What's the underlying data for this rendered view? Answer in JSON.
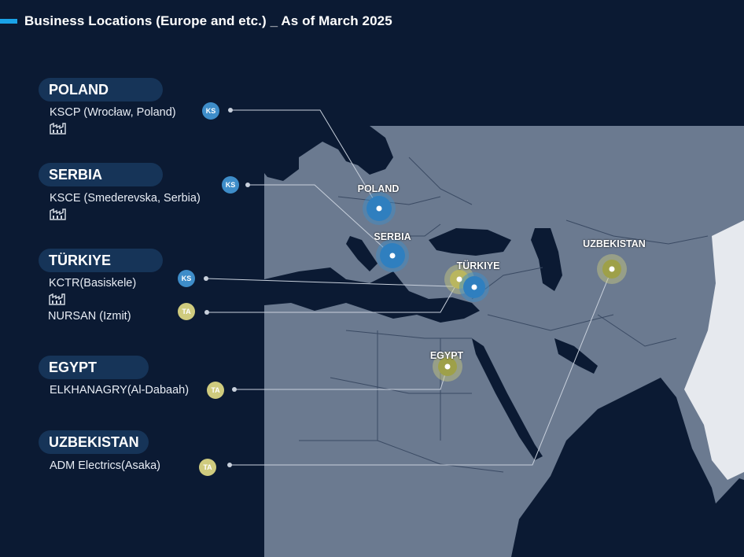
{
  "title": "Business Locations (Europe and etc.) _ As of March 2025",
  "colors": {
    "background": "#0b1a33",
    "land": "#6b7a90",
    "sea": "#0b1a33",
    "accent": "#1aa3e8",
    "ks_badge": "#3e8dc9",
    "ta_badge": "#cfcb7e"
  },
  "locations": [
    {
      "country": "POLAND",
      "sites": [
        {
          "name": "KSCP (Wrocław, Poland)",
          "badge": "KS",
          "factory": true
        }
      ],
      "map_label": "POLAND"
    },
    {
      "country": "SERBIA",
      "sites": [
        {
          "name": "KSCE (Smederevska, Serbia)",
          "badge": "KS",
          "factory": true
        }
      ],
      "map_label": "SERBIA"
    },
    {
      "country": "TÜRKIYE",
      "sites": [
        {
          "name": "KCTR(Basiskele)",
          "badge": "KS",
          "factory": true
        },
        {
          "name": "NURSAN (Izmit)",
          "badge": "TA",
          "factory": false
        }
      ],
      "map_label": "TÜRKIYE"
    },
    {
      "country": "EGYPT",
      "sites": [
        {
          "name": "ELKHANAGRY(Al-Dabaah)",
          "badge": "TA",
          "factory": false
        }
      ],
      "map_label": "EGYPT"
    },
    {
      "country": "UZBEKISTAN",
      "sites": [
        {
          "name": "ADM Electrics(Asaka)",
          "badge": "TA",
          "factory": false
        }
      ],
      "map_label": "UZBEKISTAN"
    }
  ],
  "icons": {
    "factory": "factory-icon",
    "marker": "location-marker-icon"
  }
}
